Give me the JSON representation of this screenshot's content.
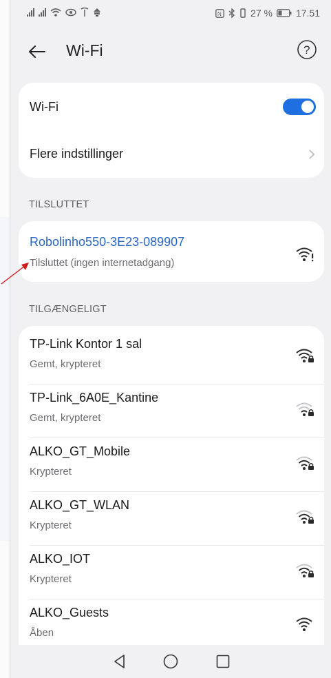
{
  "status_bar": {
    "left_icons": [
      "signal-icon",
      "signal-icon",
      "wifi-icon",
      "eye-icon",
      "antenna-icon",
      "notification-icon"
    ],
    "right_icons": [
      "nfc-icon",
      "bluetooth-icon",
      "vibrate-icon"
    ],
    "battery_text": "27 %",
    "time": "17.51"
  },
  "header": {
    "title": "Wi-Fi",
    "back_icon": "arrow-left-icon",
    "help_icon": "help-circle-icon"
  },
  "settings_card": {
    "wifi_label": "Wi-Fi",
    "wifi_enabled": true,
    "more_settings_label": "Flere indstillinger"
  },
  "connected_section": {
    "label": "TILSLUTTET",
    "network": {
      "name": "Robolinho550-3E23-089907",
      "status": "Tilsluttet (ingen internetadgang)",
      "icon": "wifi-no-internet-icon"
    }
  },
  "available_section": {
    "label": "TILGÆNGELIGT",
    "networks": [
      {
        "name": "TP-Link Kontor 1 sal",
        "status": "Gemt, krypteret",
        "icon": "wifi-locked-icon"
      },
      {
        "name": "TP-Link_6A0E_Kantine",
        "status": "Gemt, krypteret",
        "icon": "wifi-locked-icon"
      },
      {
        "name": "ALKO_GT_Mobile",
        "status": "Krypteret",
        "icon": "wifi-locked-icon"
      },
      {
        "name": "ALKO_GT_WLAN",
        "status": "Krypteret",
        "icon": "wifi-locked-icon"
      },
      {
        "name": "ALKO_IOT",
        "status": "Krypteret",
        "icon": "wifi-locked-icon"
      },
      {
        "name": "ALKO_Guests",
        "status": "Åben",
        "icon": "wifi-open-icon"
      }
    ]
  },
  "nav_bar": {
    "back_icon": "triangle-back-icon",
    "home_icon": "circle-home-icon",
    "recents_icon": "square-recents-icon"
  },
  "colors": {
    "accent": "#1f6fe0",
    "connected_text": "#2a66c4",
    "annotation_arrow": "#d11a1a"
  }
}
